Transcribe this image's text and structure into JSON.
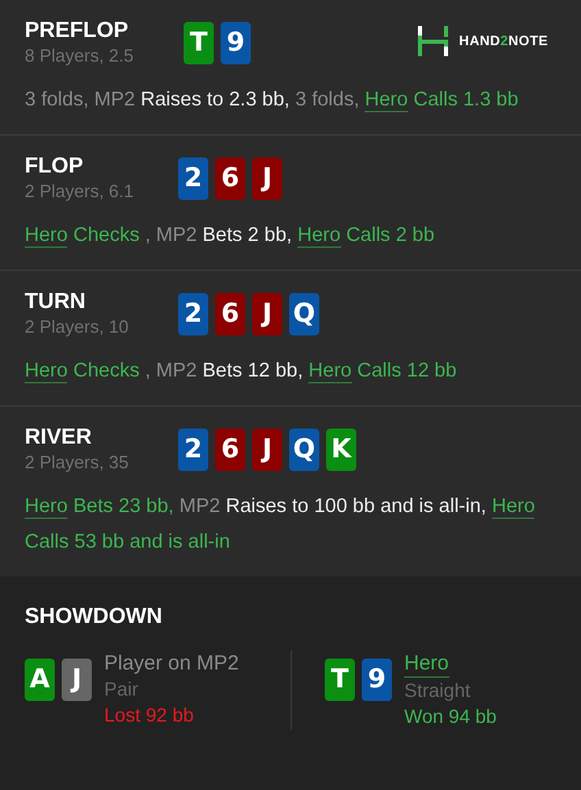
{
  "logo": {
    "parts": [
      {
        "text": "HAND",
        "accent": false
      },
      {
        "text": "2",
        "accent": true
      },
      {
        "text": "NOTE",
        "accent": false
      }
    ]
  },
  "streets": [
    {
      "title": "PREFLOP",
      "info": "8 Players, 2.5",
      "cards": [
        {
          "rank": "T",
          "color": "#0a8f12"
        },
        {
          "rank": "9",
          "color": "#0a56a6"
        }
      ],
      "actions": [
        {
          "kind": "fold",
          "text": "3 folds, MP2"
        },
        {
          "kind": "action",
          "text": "Raises to 2.3 bb,"
        },
        {
          "kind": "fold",
          "text": "3 folds,"
        },
        {
          "kind": "hero",
          "name": "Hero",
          "text": "Calls 1.3 bb"
        }
      ]
    },
    {
      "title": "FLOP",
      "info": "2 Players, 6.1",
      "cards": [
        {
          "rank": "2",
          "color": "#0a56a6"
        },
        {
          "rank": "6",
          "color": "#8c0000"
        },
        {
          "rank": "J",
          "color": "#8c0000"
        }
      ],
      "actions": [
        {
          "kind": "hero",
          "name": "Hero",
          "text": "Checks"
        },
        {
          "kind": "fold",
          "text": ", MP2"
        },
        {
          "kind": "action",
          "text": "Bets 2 bb,"
        },
        {
          "kind": "hero",
          "name": "Hero",
          "text": "Calls 2 bb"
        }
      ]
    },
    {
      "title": "TURN",
      "info": "2 Players, 10",
      "cards": [
        {
          "rank": "2",
          "color": "#0a56a6"
        },
        {
          "rank": "6",
          "color": "#8c0000"
        },
        {
          "rank": "J",
          "color": "#8c0000"
        },
        {
          "rank": "Q",
          "color": "#0a56a6"
        }
      ],
      "actions": [
        {
          "kind": "hero",
          "name": "Hero",
          "text": "Checks"
        },
        {
          "kind": "fold",
          "text": ", MP2"
        },
        {
          "kind": "action",
          "text": "Bets 12 bb,"
        },
        {
          "kind": "hero",
          "name": "Hero",
          "text": "Calls 12 bb"
        }
      ]
    },
    {
      "title": "RIVER",
      "info": "2 Players, 35",
      "cards": [
        {
          "rank": "2",
          "color": "#0a56a6"
        },
        {
          "rank": "6",
          "color": "#8c0000"
        },
        {
          "rank": "J",
          "color": "#8c0000"
        },
        {
          "rank": "Q",
          "color": "#0a56a6"
        },
        {
          "rank": "K",
          "color": "#0a8f12"
        }
      ],
      "actions": [
        {
          "kind": "hero",
          "name": "Hero",
          "text": "Bets 23 bb,"
        },
        {
          "kind": "fold",
          "text": "MP2"
        },
        {
          "kind": "action",
          "text": "Raises to 100 bb and is all-in,"
        },
        {
          "kind": "hero",
          "name": "Hero",
          "text": "Calls 53 bb and is all-in"
        }
      ]
    }
  ],
  "showdown": {
    "title": "SHOWDOWN",
    "players": [
      {
        "cards": [
          {
            "rank": "A",
            "color": "#0a8f12"
          },
          {
            "rank": "J",
            "color": "#666666"
          }
        ],
        "name": "Player on MP2",
        "hero": false,
        "hand": "Pair",
        "result": "Lost 92 bb",
        "won": false
      },
      {
        "cards": [
          {
            "rank": "T",
            "color": "#0a8f12"
          },
          {
            "rank": "9",
            "color": "#0a56a6"
          }
        ],
        "name": "Hero",
        "hero": true,
        "hand": "Straight",
        "result": "Won 94 bb",
        "won": true
      }
    ]
  }
}
